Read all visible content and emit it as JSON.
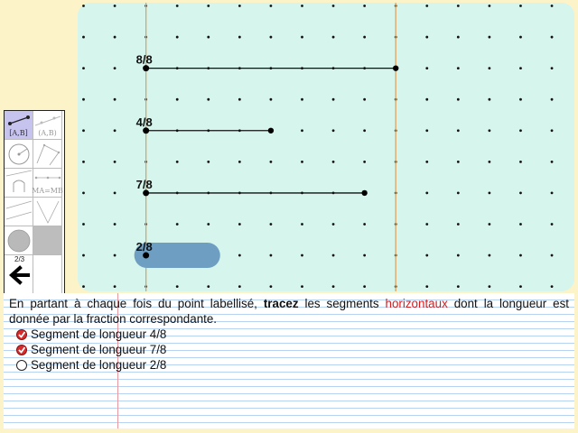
{
  "toolbar": {
    "tools": [
      {
        "label": "[A,B]",
        "icon": "segment-tool-icon",
        "active": true
      },
      {
        "label": "(A,B)",
        "icon": "line-tool-icon",
        "active": false
      },
      {
        "label": "",
        "icon": "circle-tool-icon",
        "active": false
      },
      {
        "label": "",
        "icon": "polygon-tool-icon",
        "active": false
      },
      {
        "label": "",
        "icon": "perpendicular-tool-icon",
        "active": false
      },
      {
        "label": "MA=MB",
        "icon": "midpoint-tool-icon",
        "active": false
      },
      {
        "label": "",
        "icon": "parallel-tool-icon",
        "active": false
      },
      {
        "label": "",
        "icon": "angle-tool-icon",
        "active": false
      }
    ],
    "page_indicator": "2/3"
  },
  "graph": {
    "labels": [
      {
        "text": "8/8",
        "fraction": 1.0
      },
      {
        "text": "4/8",
        "fraction": 0.5
      },
      {
        "text": "7/8",
        "fraction": 0.875
      },
      {
        "text": "2/8",
        "fraction": 0.25
      }
    ],
    "drawn_segments": [
      {
        "row": "8/8",
        "length_units": 8
      },
      {
        "row": "4/8",
        "length_units": 4
      },
      {
        "row": "7/8",
        "length_units": 7
      }
    ],
    "pending_segment": {
      "row": "2/8",
      "length_units": 2
    }
  },
  "instruction": {
    "part1": "En partant à chaque fois du point labellisé, ",
    "bold": "tracez",
    "part2": " les segments ",
    "red": "horizontaux",
    "part3": " dont la longueur est donnée par la fraction correspondante."
  },
  "tasks": [
    {
      "label": "Segment de longueur 4/8",
      "done": true
    },
    {
      "label": "Segment de longueur 7/8",
      "done": true
    },
    {
      "label": "Segment de longueur 2/8",
      "done": false
    }
  ],
  "colors": {
    "background": "#fdf3c8",
    "canvas": "#d6f5ec",
    "reference_line": "#d9a566",
    "pending_highlight": "#6f9ec3",
    "accent_red": "#d21e1e"
  }
}
